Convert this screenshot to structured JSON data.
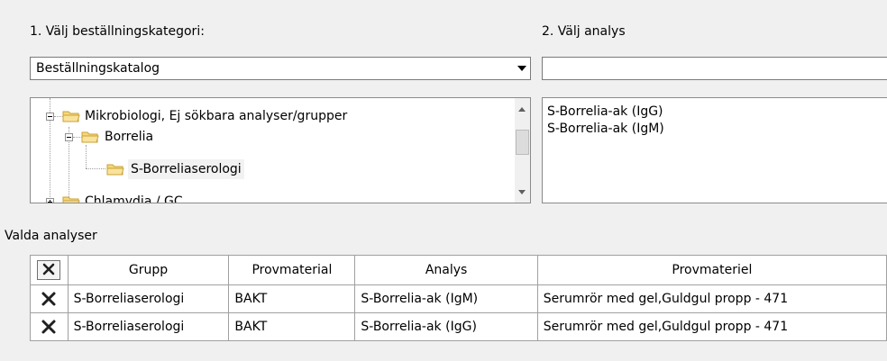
{
  "step1": {
    "label": "1. Välj beställningskategori:",
    "combo_value": "Beställningskatalog"
  },
  "step2": {
    "label": "2. Välj analys",
    "search_value": "",
    "analyses": [
      "S-Borrelia-ak (IgG)",
      "S-Borrelia-ak (IgM)"
    ]
  },
  "tree": {
    "items": [
      {
        "label": "Mikrobiologi, Ej sökbara analyser/grupper",
        "expanded": true
      },
      {
        "label": "Borrelia",
        "expanded": true
      },
      {
        "label": "S-Borreliaserologi",
        "selected": true
      },
      {
        "label": "Chlamydia / GC",
        "expanded": false
      }
    ]
  },
  "selected": {
    "title": "Valda analyser",
    "columns": [
      "Grupp",
      "Provmaterial",
      "Analys",
      "Provmateriel"
    ],
    "rows": [
      {
        "grupp": "S-Borreliaserologi",
        "provmaterial": "BAKT",
        "analys": "S-Borrelia-ak (IgM)",
        "provmateriel": "Serumrör med gel,Guldgul propp - 471"
      },
      {
        "grupp": "S-Borreliaserologi",
        "provmaterial": "BAKT",
        "analys": "S-Borrelia-ak (IgG)",
        "provmateriel": "Serumrör med gel,Guldgul propp - 471"
      }
    ]
  },
  "icons": {
    "folder": "folder-icon",
    "delete": "delete-x-icon"
  },
  "colors": {
    "folder_fill": "#f5d77a",
    "folder_stroke": "#c9a23a",
    "selection": "#f2f2f2"
  }
}
